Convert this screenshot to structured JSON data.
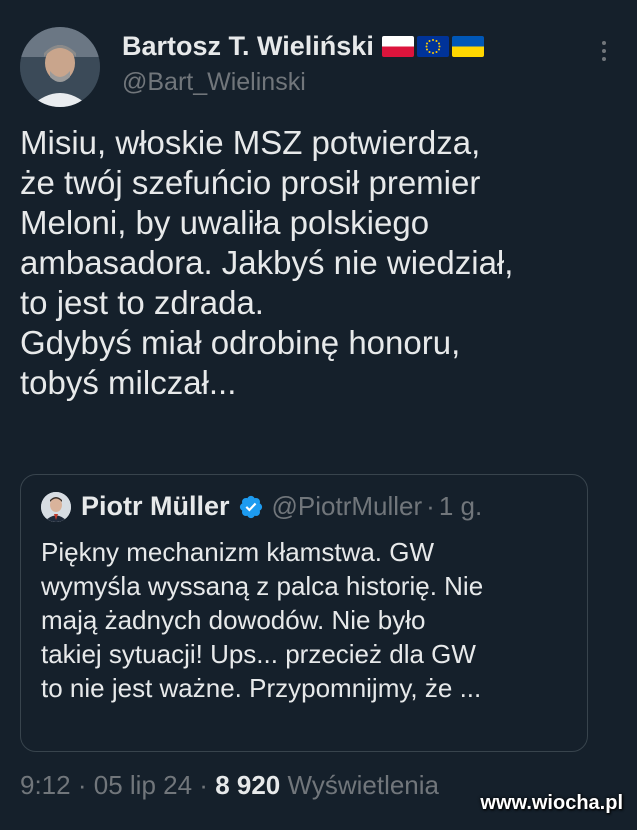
{
  "tweet": {
    "author_name": "Bartosz T. Wieliński",
    "author_handle": "@Bart_Wielinski",
    "flags": [
      "poland-flag-icon",
      "eu-flag-icon",
      "ukraine-flag-icon"
    ],
    "text_lines": [
      "Misiu, włoskie MSZ potwierdza,",
      "że twój szefuńcio prosił premier",
      "Meloni, by uwaliła polskiego",
      "ambasadora.  Jakbyś nie wiedział,",
      "to jest to zdrada.",
      "Gdybyś miał odrobinę honoru,",
      "tobyś milczał..."
    ],
    "time": "9:12",
    "date": "05 lip 24",
    "views_count": "8 920",
    "views_label": "Wyświetlenia"
  },
  "quoted": {
    "author_name": "Piotr Müller",
    "author_handle": "@PiotrMuller",
    "age": "1 g.",
    "text_lines": [
      "Piękny mechanizm kłamstwa. GW",
      "wymyśla wyssaną z palca historię. Nie",
      "mają żadnych dowodów. Nie było",
      "takiej sytuacji! Ups... przecież dla GW",
      "to nie jest ważne. Przypomnijmy, że ..."
    ]
  },
  "separator": "·",
  "watermark": "www.wiocha.pl",
  "colors": {
    "background": "#15202b",
    "text": "#e7e9ea",
    "muted": "#71767b",
    "border": "#38444d",
    "verified": "#1d9bf0"
  }
}
